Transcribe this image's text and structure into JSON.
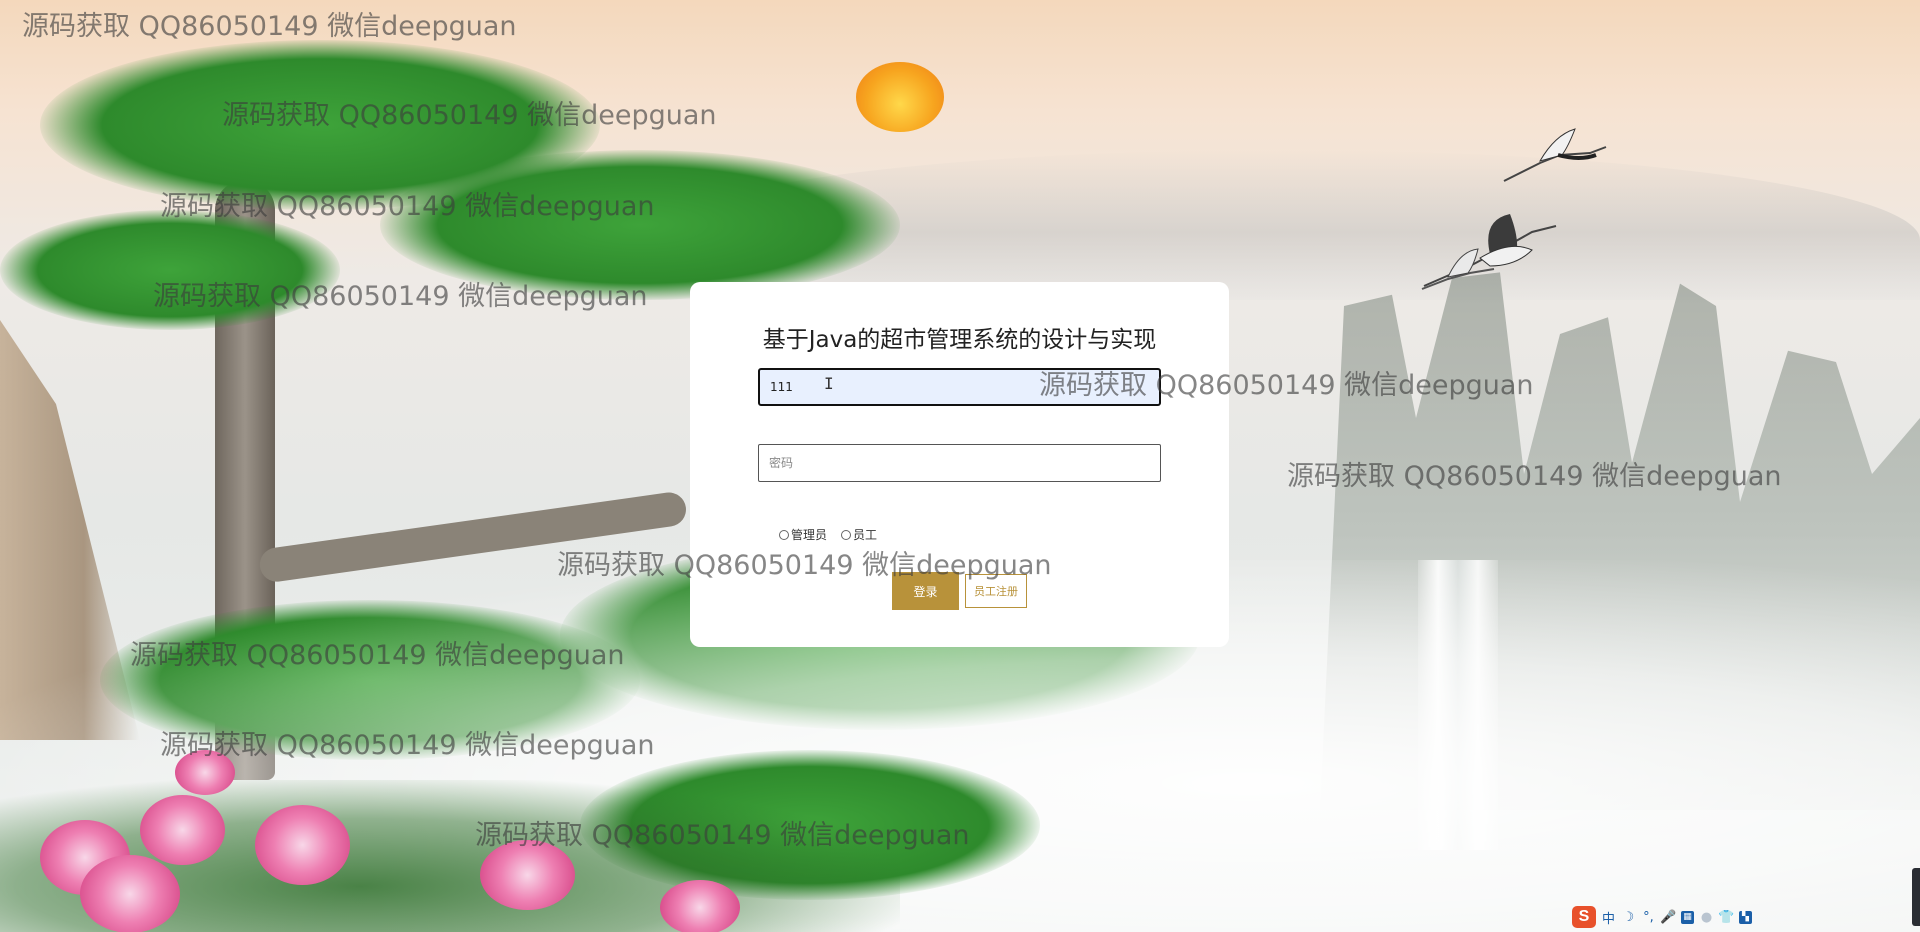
{
  "login": {
    "title": "基于Java的超市管理系统的设计与实现",
    "username_value": "111",
    "password_placeholder": "密码",
    "roles": [
      "管理员",
      "员工"
    ],
    "login_button": "登录",
    "register_button": "员工注册"
  },
  "watermarks": [
    "源码获取 QQ86050149 微信deepguan",
    "源码获取 QQ86050149 微信deepguan",
    "源码获取 QQ86050149 微信deepguan",
    "源码获取 QQ86050149 微信deepguan",
    "源码获取 QQ86050149 微信deepguan",
    "源码获取 QQ86050149 微信deepguan",
    "源码获取 QQ86050149 微信deepguan",
    "源码获取 QQ86050149 微信deepguan",
    "源码获取 QQ86050149 微信deepguan",
    "源码获取 QQ86050149 微信deepguan"
  ],
  "ime_toolbar": {
    "logo": "S",
    "mode": "中",
    "icons": [
      "moon-icon",
      "punctuation-icon",
      "microphone-icon",
      "keyboard-icon",
      "user-icon",
      "shirt-icon",
      "grid-icon"
    ]
  },
  "colors": {
    "accent_gold": "#b8923a",
    "input_autofill": "#e8f0fe",
    "ime_blue": "#1b5fa8",
    "ime_logo": "#e8512b"
  }
}
